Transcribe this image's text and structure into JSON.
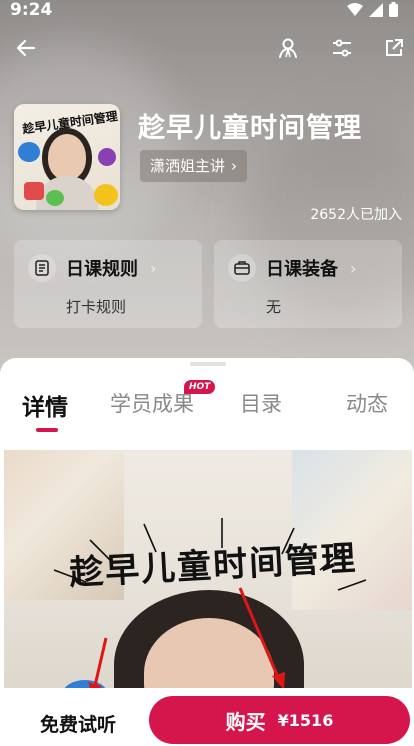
{
  "status_bar": {
    "time": "9:24"
  },
  "course": {
    "title": "趁早儿童时间管理",
    "lecturer": "潇洒姐主讲",
    "joined": "2652人已加入",
    "cover_text": "趁早儿童时间管理"
  },
  "cards": [
    {
      "title": "日课规则",
      "subtitle": "打卡规则",
      "icon": "document-icon"
    },
    {
      "title": "日课装备",
      "subtitle": "无",
      "icon": "briefcase-icon"
    }
  ],
  "tabs": [
    {
      "label": "详情",
      "active": true
    },
    {
      "label": "学员成果",
      "badge": "HOT"
    },
    {
      "label": "目录"
    },
    {
      "label": "动态"
    }
  ],
  "poster": {
    "title": "趁早儿童时间管理"
  },
  "bottom": {
    "free_listen": "免费试听",
    "buy_label": "购买",
    "buy_price": "¥1516"
  },
  "colors": {
    "accent": "#d5164d"
  }
}
